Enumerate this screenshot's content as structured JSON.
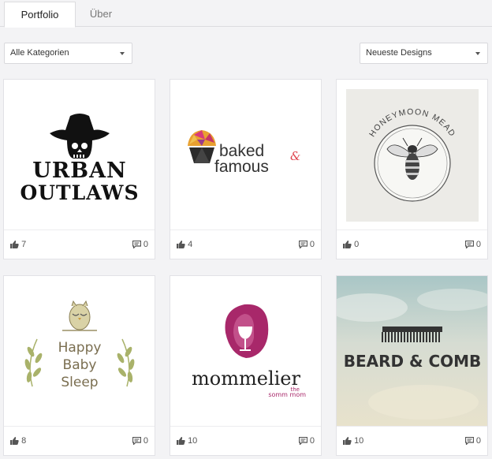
{
  "tabs": [
    {
      "label": "Portfolio",
      "active": true
    },
    {
      "label": "Über",
      "active": false
    }
  ],
  "filters": {
    "category": "Alle Kategorien",
    "sort": "Neueste Designs"
  },
  "designs": [
    {
      "logo": {
        "line1": "URBAN",
        "line2": "OUTLAWS"
      },
      "likes": "7",
      "comments": "0"
    },
    {
      "logo": {
        "word1": "baked",
        "amp": "&",
        "word2": "famous"
      },
      "likes": "4",
      "comments": "0"
    },
    {
      "logo": {
        "text": "HONEYMOON MEAD"
      },
      "likes": "0",
      "comments": "0"
    },
    {
      "logo": {
        "line1": "Happy",
        "line2": "Baby",
        "line3": "Sleep"
      },
      "likes": "8",
      "comments": "0"
    },
    {
      "logo": {
        "word": "mommelier",
        "tag1": "the",
        "tag2": "somm mom"
      },
      "likes": "10",
      "comments": "0"
    },
    {
      "logo": {
        "text": "BEARD & COMB"
      },
      "likes": "10",
      "comments": "0"
    }
  ],
  "colors": {
    "page_bg": "#f3f3f5",
    "card_border": "#e2e2e6",
    "mommelier_accent": "#a8286a",
    "baked_accent": "#e0454f"
  },
  "icons": {
    "likes": "thumbs-up-icon",
    "comments": "speech-bubble-icon",
    "dropdown": "chevron-down-icon"
  }
}
